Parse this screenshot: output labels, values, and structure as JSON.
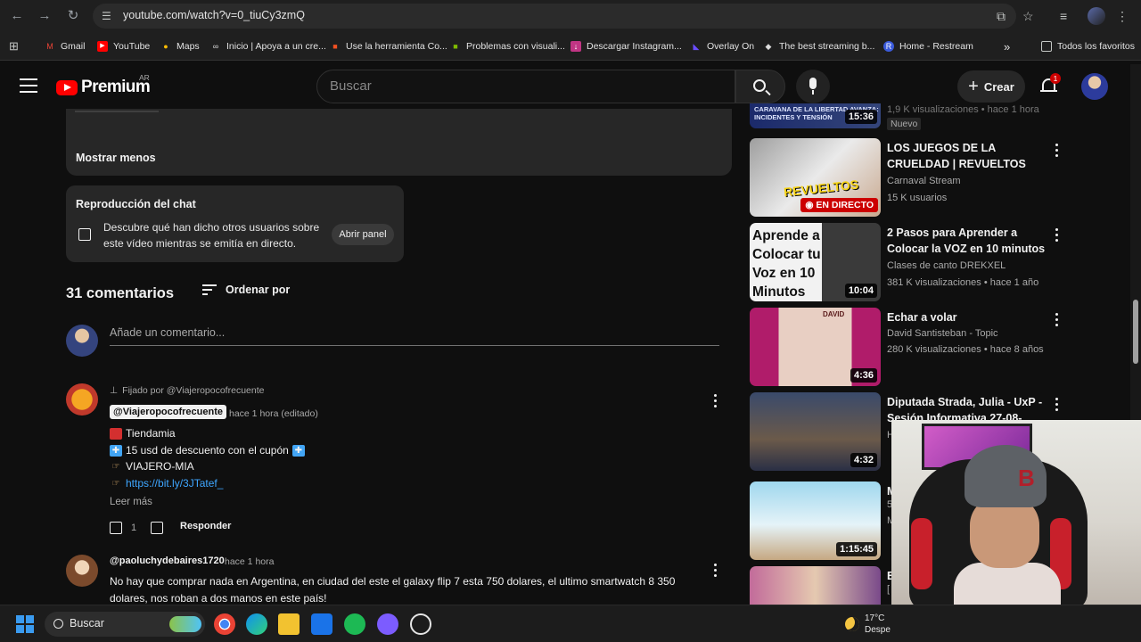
{
  "browser": {
    "url": "youtube.com/watch?v=0_tiuCy3zmQ",
    "bookmarks": [
      {
        "label": "Gmail",
        "color": "#ea4335",
        "glyph": "M"
      },
      {
        "label": "YouTube",
        "color": "#ff0000",
        "glyph": "▶"
      },
      {
        "label": "Maps",
        "color": "#34a853",
        "glyph": "●"
      },
      {
        "label": "Inicio | Apoya a un cre...",
        "color": "#555555",
        "glyph": "∞"
      },
      {
        "label": "Use la herramienta Co...",
        "color": "#f25022",
        "glyph": "■"
      },
      {
        "label": "Problemas con visuali...",
        "color": "#7fba00",
        "glyph": "■"
      },
      {
        "label": "Descargar Instagram...",
        "color": "#c13584",
        "glyph": "↓"
      },
      {
        "label": "Overlay On",
        "color": "#6a4cff",
        "glyph": "◣"
      },
      {
        "label": "The best streaming b...",
        "color": "#dddddd",
        "glyph": "◆"
      },
      {
        "label": "Home - Restream",
        "color": "#3b5bdb",
        "glyph": "R"
      }
    ],
    "bookmarks_more": "»",
    "all_bookmarks": "Todos los favoritos"
  },
  "header": {
    "logo_text": "Premium",
    "country": "AR",
    "search_placeholder": "Buscar",
    "create_label": "Crear",
    "notification_count": "1"
  },
  "description": {
    "show_less": "Mostrar menos"
  },
  "chat_replay": {
    "title": "Reproducción del chat",
    "description": "Descubre qué han dicho otros usuarios sobre este vídeo mientras se emitía en directo.",
    "button": "Abrir panel"
  },
  "comments": {
    "count_label": "31 comentarios",
    "sort_label": "Ordenar por",
    "add_placeholder": "Añade un comentario...",
    "pinned": {
      "pinned_by": "Fijado por @Viajeropocofrecuente",
      "author": "@Viajeropocofrecuente",
      "time": "hace 1 hora (editado)",
      "lines": [
        "Tiendamia",
        "15 usd de descuento con el cupón",
        "VIAJERO-MIA"
      ],
      "link": "https://bit.ly/3JTatef_",
      "read_more": "Leer más",
      "likes": "1",
      "reply": "Responder"
    },
    "second": {
      "author": "@paoluchydebaires1720",
      "time": "hace 1 hora",
      "text": "No hay que comprar nada en Argentina, en ciudad del este el galaxy flip 7 esta 750 dolares, el ultimo smartwatch 8 350 dolares, nos roban a dos manos en este país!"
    }
  },
  "recommendations": {
    "top": {
      "caption": "CARAVANA DE LA LIBERTAD AVANZA: INCIDENTES Y TENSIÓN",
      "duration": "15:36",
      "meta": "1,9 K visualizaciones • hace 1 hora",
      "badge": "Nuevo"
    },
    "items": [
      {
        "title": "LOS JUEGOS DE LA CRUELDAD | REVUELTOS",
        "channel": "Carnaval Stream",
        "meta": "15 K usuarios",
        "live": "EN DIRECTO",
        "thumb_text": "REVUELTOS"
      },
      {
        "title": "2 Pasos para Aprender a Colocar la VOZ  en 10 minutos",
        "channel": "Clases de canto DREKXEL",
        "meta": "381 K visualizaciones • hace 1 año",
        "duration": "10:04",
        "thumb_text": "Aprende a Colocar tu Voz en 10 Minutos"
      },
      {
        "title": "Echar a volar",
        "channel": "David Santisteban - Topic",
        "meta": "280 K visualizaciones • hace 8 años",
        "duration": "4:36",
        "thumb_text": "DAVID"
      },
      {
        "title": "Diputada Strada, Julia - UxP - Sesión Informativa 27-08-2025",
        "channel": "H",
        "meta": "",
        "duration": "4:32",
        "thumb_text": ""
      },
      {
        "title": "M",
        "channel": "5",
        "meta": "M",
        "duration": "1:15:45",
        "thumb_text": ""
      },
      {
        "title": "E",
        "channel": "[",
        "meta": "",
        "duration": "",
        "thumb_text": ""
      }
    ]
  },
  "taskbar": {
    "search_placeholder": "Buscar",
    "temperature": "17°C",
    "weather": "Despe"
  },
  "colors": {
    "background": "#0f0f0f",
    "surface": "#272727",
    "link": "#3ea6ff",
    "youtube_red": "#ff0000"
  }
}
